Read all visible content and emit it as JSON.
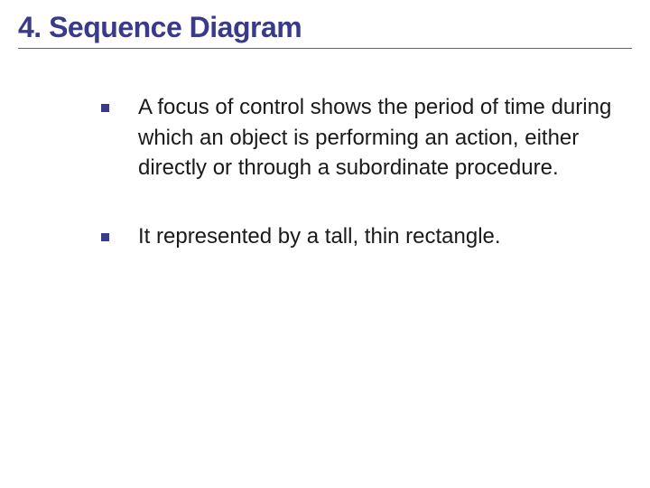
{
  "slide": {
    "title": "4. Sequence Diagram",
    "bullets": [
      "A focus of control shows the period of time during which an object is performing an action, either directly or through a subordinate procedure.",
      "It represented by a tall, thin rectangle."
    ]
  }
}
